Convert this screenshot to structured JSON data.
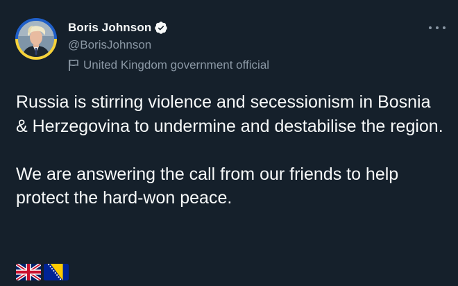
{
  "author": {
    "display_name": "Boris Johnson",
    "handle": "@BorisJohnson",
    "affiliation": "United Kingdom government official",
    "verified": true
  },
  "tweet": {
    "paragraphs": [
      "Russia is stirring violence and secessionism in Bosnia & Herzegovina to undermine and destabilise the region.",
      "We are answering the call from our friends to help protect the hard-won peace."
    ],
    "emojis": [
      "uk-flag",
      "bosnia-herzegovina-flag"
    ]
  },
  "colors": {
    "background": "#15202b",
    "text_primary": "#f7f9f9",
    "text_secondary": "#8b98a5",
    "ring_blue": "#1f5fc9",
    "ring_yellow": "#f6d23a"
  },
  "icons": {
    "verified": "verified-badge-icon",
    "affiliation": "flag-icon",
    "more": "more-horizontal-icon"
  }
}
